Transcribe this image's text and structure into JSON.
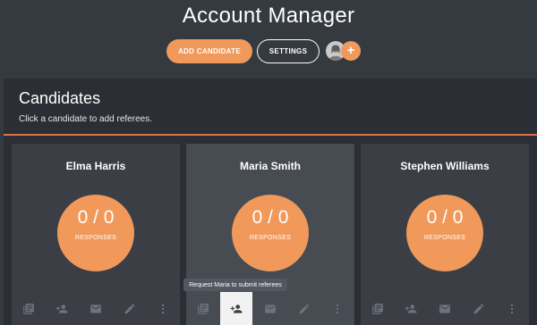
{
  "app": {
    "title": "Account Manager"
  },
  "toolbar": {
    "add_label": "ADD CANDIDATE",
    "settings_label": "SETTINGS",
    "add_icon": "+"
  },
  "colors": {
    "background": "#353940",
    "accent": "#f0995b",
    "panel": "#2b2e34",
    "card": "#3b3e45",
    "rule": "#e0704a"
  },
  "section": {
    "title": "Candidates",
    "subtitle": "Click a candidate to add referees."
  },
  "candidates": [
    {
      "name": "Elma Harris",
      "count": "0 / 0",
      "label": "RESPONSES"
    },
    {
      "name": "Maria Smith",
      "count": "0 / 0",
      "label": "RESPONSES"
    },
    {
      "name": "Stephen Williams",
      "count": "0 / 0",
      "label": "RESPONSES"
    }
  ],
  "card_actions": [
    "library-icon",
    "add-referees-icon",
    "email-icon",
    "edit-icon",
    "more-vert-icon"
  ],
  "tooltip": {
    "text": "Request Maria to submit referees"
  }
}
